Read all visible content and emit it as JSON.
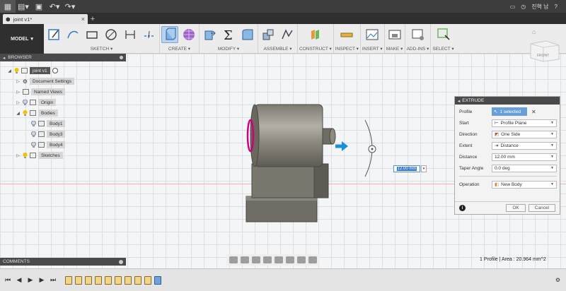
{
  "tab": {
    "title": "joint v1*"
  },
  "user": {
    "name": "진혁 남"
  },
  "toolbar": {
    "model_label": "MODEL",
    "groups": [
      "SKETCH",
      "CREATE",
      "MODIFY",
      "ASSEMBLE",
      "CONSTRUCT",
      "INSPECT",
      "INSERT",
      "MAKE",
      "ADD-INS",
      "SELECT"
    ]
  },
  "browser": {
    "title": "BROWSER",
    "root": "joint v1",
    "items": [
      "Document Settings",
      "Named Views",
      "Origin",
      "Bodies",
      "Body1",
      "Body3",
      "Body4",
      "Sketches"
    ]
  },
  "comments": {
    "title": "COMMENTS"
  },
  "viewcube": {
    "label": "FRONT"
  },
  "extrude": {
    "title": "EXTRUDE",
    "profile_label": "Profile",
    "profile_value": "1 selected",
    "start_label": "Start",
    "start_value": "Profile Plane",
    "direction_label": "Direction",
    "direction_value": "One Side",
    "extent_label": "Extent",
    "extent_value": "Distance",
    "distance_label": "Distance",
    "distance_value": "12.00 mm",
    "taper_label": "Taper Angle",
    "taper_value": "0.0 deg",
    "operation_label": "Operation",
    "operation_value": "New Body",
    "ok_label": "OK",
    "cancel_label": "Cancel"
  },
  "canvas_input": {
    "value": "12.00 mm"
  },
  "status": {
    "text": "1 Profile | Area : 20.964 mm^2"
  },
  "colors": {
    "accent": "#6a9fd5",
    "profile": "#d0007a"
  }
}
